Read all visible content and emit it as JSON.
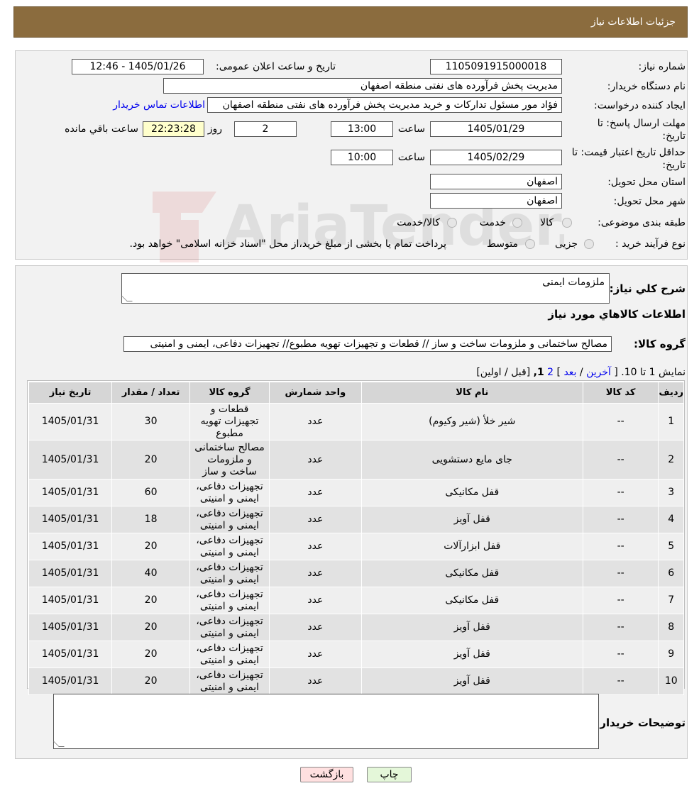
{
  "header": {
    "title": "جزئیات اطلاعات نیاز"
  },
  "form": {
    "need_number_label": "شماره نیاز:",
    "need_number": "1105091915000018",
    "announce_label": "تاریخ و ساعت اعلان عمومی:",
    "announce_value": "1405/01/26 - 12:46",
    "buyer_org_label": "نام دستگاه خریدار:",
    "buyer_org": "مدیریت پخش فرآورده های نفتی منطقه اصفهان",
    "creator_label": "ایجاد کننده درخواست:",
    "creator": "فؤاد مور مسئول تدارکات و خرید مدیریت پخش فرآورده های نفتی منطقه اصفهان",
    "contact_link": "اطلاعات تماس خریدار",
    "deadline_label_1": "مهلت ارسال پاسخ: تا",
    "deadline_label_2": "تاریخ:",
    "deadline_date": "1405/01/29",
    "time_label": "ساعت",
    "deadline_time": "13:00",
    "days_value": "2",
    "days_label": "روز و",
    "remaining_time": "22:23:28",
    "remaining_label": "ساعت باقي مانده",
    "validity_label_1": "حداقل تاریخ اعتبار قیمت: تا",
    "validity_label_2": "تاریخ:",
    "validity_date": "1405/02/29",
    "validity_time": "10:00",
    "province_label": "استان محل تحویل:",
    "province": "اصفهان",
    "city_label": "شهر محل تحویل:",
    "city": "اصفهان",
    "category_label": "طبقه بندی موضوعی:",
    "category_options": [
      "کالا",
      "خدمت",
      "کالا/خدمت"
    ],
    "process_label": "نوع فرآیند خرید :",
    "process_options": [
      "جزیی",
      "متوسط"
    ],
    "process_note": "پرداخت تمام یا بخشی از مبلغ خرید،از محل \"اسناد خزانه اسلامی\" خواهد بود."
  },
  "watermark": {
    "text": "AriaTender.neT"
  },
  "details": {
    "desc_label": "شرح کلي نياز:",
    "desc_value": "ملزومات ایمنی",
    "goods_title": "اطلاعات کالاهاي مورد نياز",
    "group_label": "گروه کالا:",
    "group_value": "مصالح ساختمانی و ملزومات ساخت و ساز //  قطعات و تجهیزات تهویه مطبوع// تجهیزات دفاعی، ایمنی و امنیتی",
    "pager_text": "نمایش 1 تا 10.",
    "pager_open": "[",
    "pager_last": "آخرین",
    "pager_sep1": "/",
    "pager_next": "بعد",
    "pager_close": "]",
    "pager_page2": "2",
    "pager_page1": "1,",
    "pager_nav": "[قبل / اولین]",
    "buyer_notes_label": "توضیحات خریدار:"
  },
  "table": {
    "headers": [
      "ردیف",
      "کد کالا",
      "نام کالا",
      "واحد شمارش",
      "گروه کالا",
      "تعداد / مقدار",
      "تاریخ نیاز"
    ],
    "rows": [
      [
        "1",
        "--",
        "شیر خلأ (شیر وکیوم)",
        "عدد",
        "قطعات و تجهیزات تهویه مطبوع",
        "30",
        "1405/01/31"
      ],
      [
        "2",
        "--",
        "جای مایع دستشویی",
        "عدد",
        "مصالح ساختمانی و ملزومات ساخت و ساز",
        "20",
        "1405/01/31"
      ],
      [
        "3",
        "--",
        "قفل مکانیکی",
        "عدد",
        "تجهیزات دفاعی، ایمنی و امنیتی",
        "60",
        "1405/01/31"
      ],
      [
        "4",
        "--",
        "قفل آویز",
        "عدد",
        "تجهیزات دفاعی، ایمنی و امنیتی",
        "18",
        "1405/01/31"
      ],
      [
        "5",
        "--",
        "قفل ابزارآلات",
        "عدد",
        "تجهیزات دفاعی، ایمنی و امنیتی",
        "20",
        "1405/01/31"
      ],
      [
        "6",
        "--",
        "قفل مکانیکی",
        "عدد",
        "تجهیزات دفاعی، ایمنی و امنیتی",
        "40",
        "1405/01/31"
      ],
      [
        "7",
        "--",
        "قفل مکانیکی",
        "عدد",
        "تجهیزات دفاعی، ایمنی و امنیتی",
        "20",
        "1405/01/31"
      ],
      [
        "8",
        "--",
        "قفل آویز",
        "عدد",
        "تجهیزات دفاعی، ایمنی و امنیتی",
        "20",
        "1405/01/31"
      ],
      [
        "9",
        "--",
        "قفل آویز",
        "عدد",
        "تجهیزات دفاعی، ایمنی و امنیتی",
        "20",
        "1405/01/31"
      ],
      [
        "10",
        "--",
        "قفل آویز",
        "عدد",
        "تجهیزات دفاعی، ایمنی و امنیتی",
        "20",
        "1405/01/31"
      ]
    ]
  },
  "buttons": {
    "print": "چاپ",
    "back": "بازگشت"
  }
}
